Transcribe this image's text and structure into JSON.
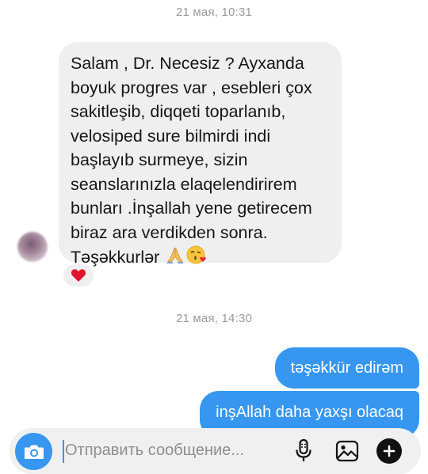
{
  "timestamps": [
    "21 мая, 10:31",
    "21 мая, 14:30"
  ],
  "incoming_message": {
    "lines": [
      "Salam , Dr. Necesiz ? Ayxanda",
      "boyuk progres var , esebleri çox",
      "sakitleşib, diqqeti toparlanıb,",
      "velosiped sure bilmirdi indi",
      "başlayıb surmeye, sizin",
      "seanslarınızla elaqelendirirem",
      "bunları .İnşallah yene getirecem",
      "biraz ara verdikden sonra.",
      "Təşəkkurlər"
    ],
    "emojis": [
      "folded-hands",
      "face-blowing-a-kiss"
    ],
    "reaction": "red-heart"
  },
  "outgoing_messages": [
    "təşəkkür edirəm",
    "inşAllah daha yaxşı olacaq"
  ],
  "composer": {
    "placeholder": "Отправить сообщение...",
    "icons": [
      "camera-icon",
      "microphone-icon",
      "gallery-icon",
      "plus-icon"
    ]
  },
  "colors": {
    "accent": "#3797f0",
    "incoming_bubble": "#efefef",
    "composer_bg": "#f0f0f0",
    "timestamp": "#9a9a9a"
  }
}
